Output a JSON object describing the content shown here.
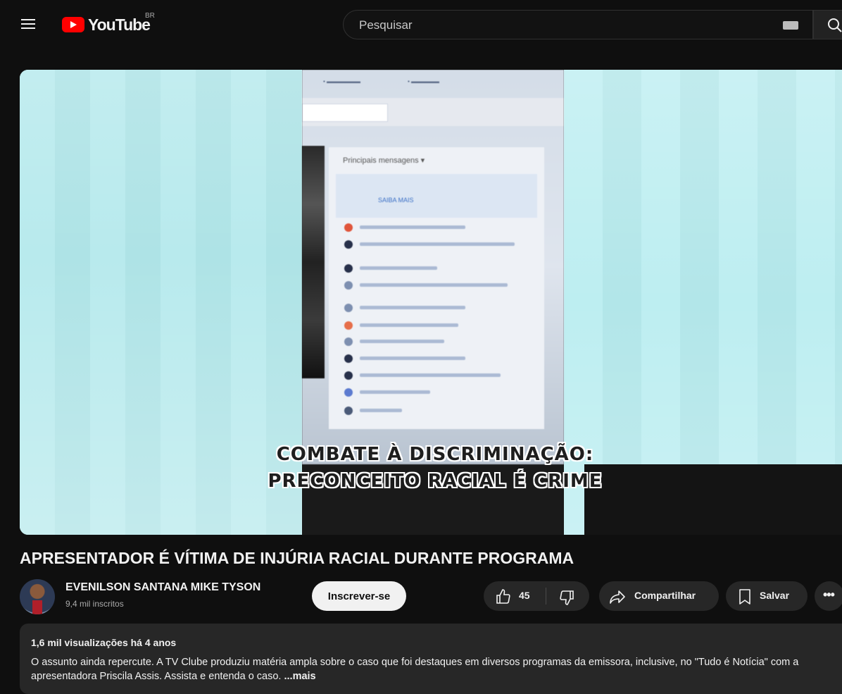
{
  "masthead": {
    "logo_text": "YouTube",
    "country_code": "BR",
    "search_placeholder": "Pesquisar"
  },
  "player": {
    "caption_line1": "COMBATE À DISCRIMINAÇÃO:",
    "caption_line2": "PRECONCEITO RACIAL É CRIME",
    "screen_title": "Principais mensagens ▾",
    "screen_link": "SAIBA MAIS"
  },
  "video": {
    "title": "APRESENTADOR É VÍTIMA DE INJÚRIA RACIAL DURANTE PROGRAMA"
  },
  "channel": {
    "name": "EVENILSON SANTANA MIKE TYSON",
    "subscribers": "9,4 mil inscritos",
    "subscribe_label": "Inscrever-se"
  },
  "actions": {
    "like_count": "45",
    "share_label": "Compartilhar",
    "save_label": "Salvar",
    "more_label": "•••"
  },
  "description": {
    "stats": "1,6 mil visualizações  há 4 anos",
    "text": "O assunto ainda repercute. A TV Clube produziu matéria ampla sobre o caso que foi destaques em diversos programas da emissora, inclusive, no \"Tudo é Notícia\" com a apresentadora Priscila Assis. Assista e entenda o caso.",
    "more_label": "...mais"
  },
  "colors": {
    "background": "#0f0f0f",
    "brand_red": "#ff0000",
    "pill_bg": "#272727"
  }
}
